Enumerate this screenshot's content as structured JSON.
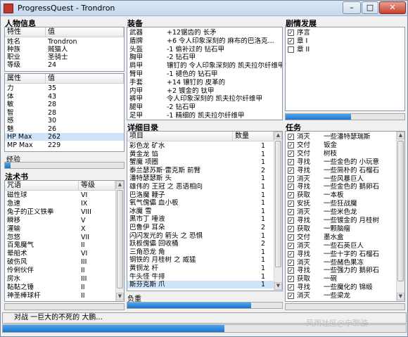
{
  "window": {
    "title": "ProgressQuest - Trondron"
  },
  "character": {
    "heading": "人物信息",
    "headers": [
      "特性",
      "值"
    ],
    "rows": [
      [
        "姓名",
        "Trondron"
      ],
      [
        "种族",
        "贼猫人"
      ],
      [
        "职业",
        "圣骑士"
      ],
      [
        "等级",
        "24"
      ]
    ],
    "stats_headers": [
      "属性",
      "值"
    ],
    "stats": [
      [
        "力",
        "35"
      ],
      [
        "体",
        "43"
      ],
      [
        "敏",
        "28"
      ],
      [
        "智",
        "28"
      ],
      [
        "感",
        "30"
      ],
      [
        "魅",
        "26"
      ],
      [
        "HP Max",
        "262"
      ],
      [
        "MP Max",
        "229"
      ]
    ],
    "exp_label": "经验",
    "exp_progress": 0.05
  },
  "spells": {
    "heading": "法术书",
    "headers": [
      "咒语",
      "等级"
    ],
    "rows": [
      [
        "磁性球",
        "VI"
      ],
      [
        "急速",
        "IX"
      ],
      [
        "兔子的正义铁拳",
        "VIII"
      ],
      [
        "瞬移",
        "V"
      ],
      [
        "灌输",
        "X"
      ],
      [
        "忽悠",
        "VII"
      ],
      [
        "百鬼魔气",
        "II"
      ],
      [
        "晕船术",
        "VI"
      ],
      [
        "破伤风",
        "III"
      ],
      [
        "伶俐伙伴",
        "II"
      ],
      [
        "房水",
        "III"
      ],
      [
        "黏黏之锤",
        "II"
      ],
      [
        "神圣棒球杆",
        "II"
      ]
    ]
  },
  "equipment": {
    "heading": "装备",
    "rows": [
      [
        "武器",
        "+12锯齿的 长矛"
      ],
      [
        "盾牌",
        "+6 令人印象深刻的 麻布的巴洛克..."
      ],
      [
        "头盔",
        "-1 偷补过的 钻石甲"
      ],
      [
        "胸甲",
        "-2 钻石甲"
      ],
      [
        "肩甲",
        "镶钉的 令人印象深刻的 凯夫拉尔纤维甲"
      ],
      [
        "臂甲",
        "-1 褪色的 钻石甲"
      ],
      [
        "手套",
        "+14 镶钉的 皮革的"
      ],
      [
        "内甲",
        "+2 镀金的 钛甲"
      ],
      [
        "裤甲",
        "令人印象深刻的 凯夫拉尔纤维甲"
      ],
      [
        "腿甲",
        "-2 钻石甲"
      ],
      [
        "足甲",
        "-1 精细的 凯夫拉尔纤维甲"
      ]
    ]
  },
  "inventory": {
    "heading": "详细目录",
    "headers": [
      "项目",
      "数量"
    ],
    "rows": [
      [
        "彩色龙 矿水",
        "1"
      ],
      [
        "黄金龙 馅",
        "1"
      ],
      [
        "蟹魔 项圈",
        "1"
      ],
      [
        "泰兰瑟苏斯·雷克斯 前臂",
        "2"
      ],
      [
        "潘特瑟瑟斯 头",
        "1"
      ],
      [
        "雄伟的 王冠 之 恶语相向",
        "1"
      ],
      [
        "巴洛魔 鞭子",
        "1"
      ],
      [
        "氧气傀儡 血小板",
        "1"
      ],
      [
        "冰魔 雪",
        "1"
      ],
      [
        "黑市丁 唾液",
        "1"
      ],
      [
        "巴鲁伊 耳朵",
        "2"
      ],
      [
        "闪闪发光的 箭头 之 恐惧",
        "1"
      ],
      [
        "跃板傀儡 回收桶",
        "2"
      ],
      [
        "三角恐龙 角",
        "1"
      ],
      [
        "钢铁的 月桂树 之 威猛",
        "1"
      ],
      [
        "黄铜龙 杆",
        "1"
      ],
      [
        "牛头怪 牛排",
        "1"
      ],
      [
        "斯芬克斯 爪",
        "1"
      ]
    ],
    "burden_label": "负重",
    "burden_progress": 0.8
  },
  "plot": {
    "heading": "剧情发展",
    "items": [
      [
        "序言",
        true
      ],
      [
        "章 I",
        true
      ],
      [
        "章 II",
        false
      ]
    ],
    "progress": 0.55
  },
  "quests": {
    "heading": "任务",
    "items": [
      [
        "消灭",
        "一些潘特瑟瑞斯"
      ],
      [
        "交付",
        "钣金"
      ],
      [
        "交付",
        "树枝"
      ],
      [
        "寻找",
        "一些金色的 小玩意"
      ],
      [
        "寻找",
        "一些简朴的 石榴石"
      ],
      [
        "消灭",
        "一些风暴巨人"
      ],
      [
        "寻找",
        "一些金色的 鹅卵石"
      ],
      [
        "获取",
        "一本板"
      ],
      [
        "安抚",
        "一些狂战魔"
      ],
      [
        "消灭",
        "一些米色龙"
      ],
      [
        "寻找",
        "一些镀金的 月桂树"
      ],
      [
        "获取",
        "一颗脑瘤"
      ],
      [
        "交付",
        "墨水盒"
      ],
      [
        "消灭",
        "一些石英巨人"
      ],
      [
        "寻找",
        "一些十字的 石榴石"
      ],
      [
        "消灭",
        "一些赭色果冻"
      ],
      [
        "寻找",
        "一些强力的 鹅卵石"
      ],
      [
        "获取",
        "一碗"
      ],
      [
        "寻找",
        "一些魔化的 锦缎"
      ],
      [
        "消灭",
        "一些梁龙"
      ]
    ],
    "progress": 0.0
  },
  "status": {
    "text": "对战 一巨大的不死的 大鹏...",
    "progress": 0.55
  },
  "watermark": "风雨社区@宁聊游"
}
